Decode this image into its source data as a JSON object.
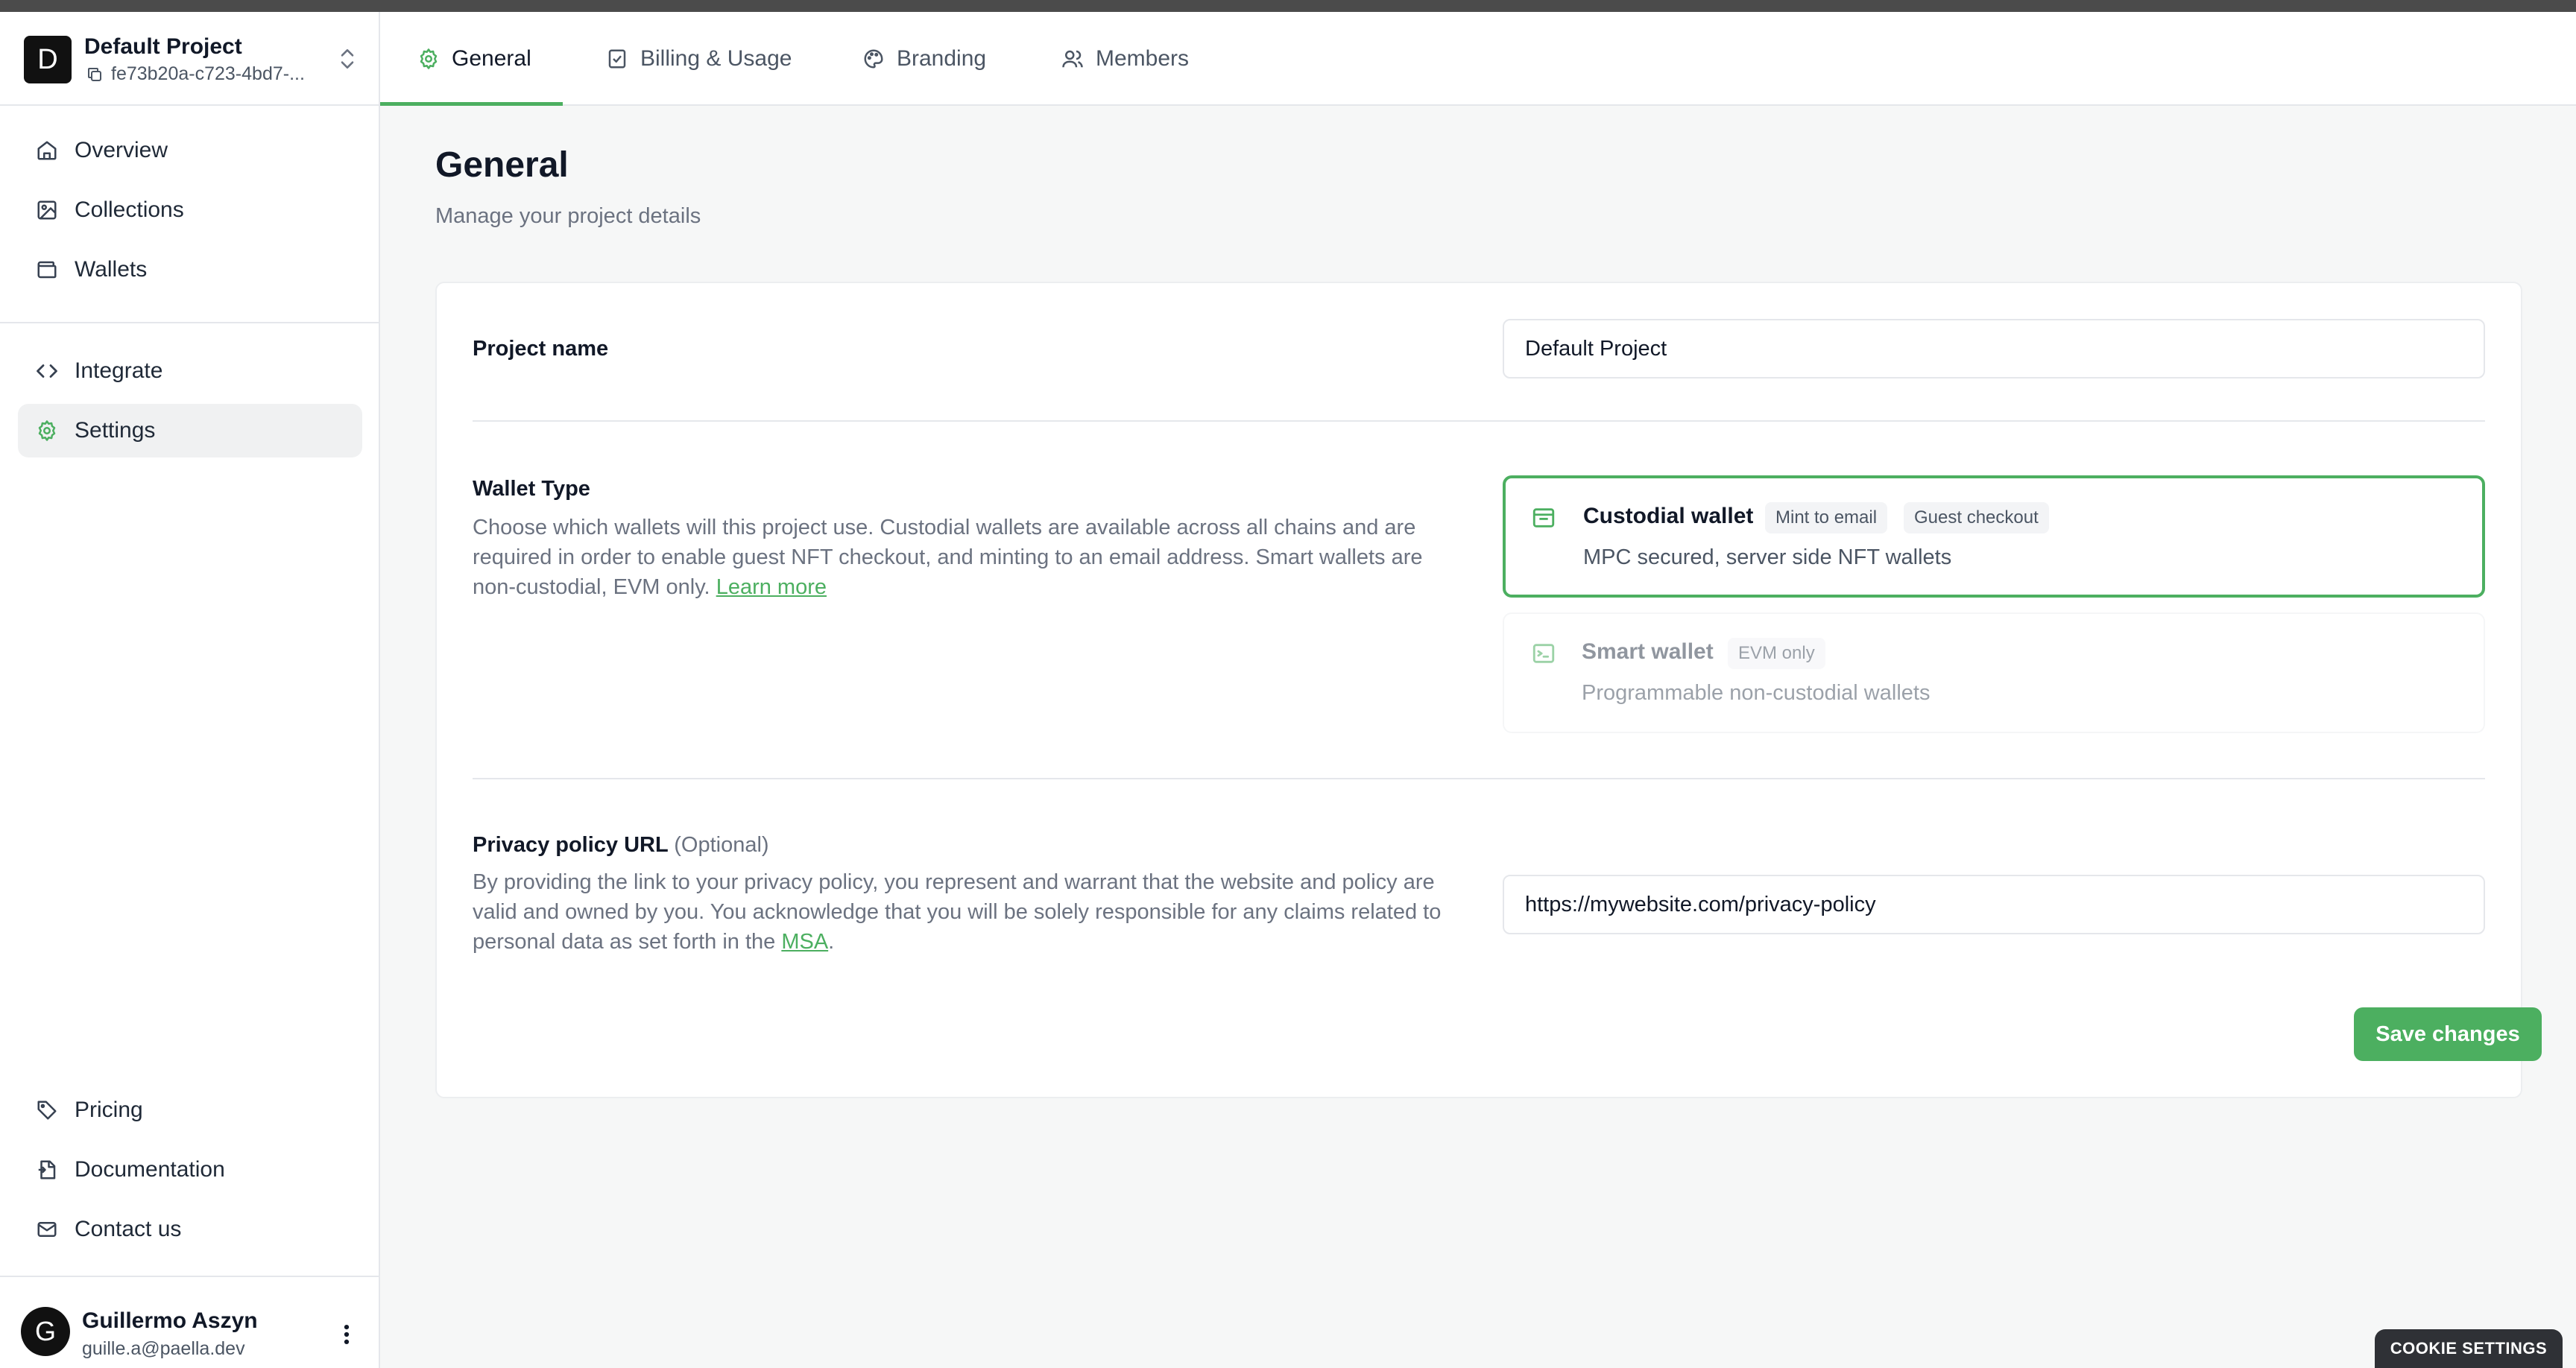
{
  "sidebar": {
    "project": {
      "initial": "D",
      "name": "Default Project",
      "id": "fe73b20a-c723-4bd7-..."
    },
    "nav_primary": [
      {
        "label": "Overview",
        "icon": "home-icon"
      },
      {
        "label": "Collections",
        "icon": "image-icon"
      },
      {
        "label": "Wallets",
        "icon": "wallet-icon"
      }
    ],
    "nav_secondary": [
      {
        "label": "Integrate",
        "icon": "code-icon"
      },
      {
        "label": "Settings",
        "icon": "gear-icon",
        "active": true
      }
    ],
    "nav_footer": [
      {
        "label": "Pricing",
        "icon": "tag-icon"
      },
      {
        "label": "Documentation",
        "icon": "document-icon"
      },
      {
        "label": "Contact us",
        "icon": "mail-icon"
      }
    ],
    "user": {
      "initial": "G",
      "name": "Guillermo Aszyn",
      "email": "guille.a@paella.dev"
    }
  },
  "tabs": [
    {
      "label": "General",
      "icon": "gear-icon",
      "active": true
    },
    {
      "label": "Billing & Usage",
      "icon": "receipt-icon"
    },
    {
      "label": "Branding",
      "icon": "palette-icon"
    },
    {
      "label": "Members",
      "icon": "users-icon"
    }
  ],
  "page": {
    "title": "General",
    "subtitle": "Manage your project details"
  },
  "project_name": {
    "label": "Project name",
    "value": "Default Project"
  },
  "wallet_type": {
    "label": "Wallet Type",
    "description": "Choose which wallets will this project use. Custodial wallets are available across all chains and are required in order to enable guest NFT checkout, and minting to an email address. Smart wallets are non-custodial, EVM only.",
    "link": "Learn more",
    "options": [
      {
        "title": "Custodial wallet",
        "badges": [
          "Mint to email",
          "Guest checkout"
        ],
        "subtitle": "MPC secured, server side NFT wallets",
        "selected": true
      },
      {
        "title": "Smart wallet",
        "badges": [
          "EVM only"
        ],
        "subtitle": "Programmable non-custodial wallets",
        "selected": false
      }
    ]
  },
  "privacy": {
    "label": "Privacy policy URL",
    "optional": "(Optional)",
    "description": "By providing the link to your privacy policy, you represent and warrant that the website and policy are valid and owned by you. You acknowledge that you will be solely responsible for any claims related to personal data as set forth in the",
    "link": "MSA",
    "value": "https://mywebsite.com/privacy-policy"
  },
  "save_label": "Save changes",
  "cookie_label": "COOKIE SETTINGS",
  "colors": {
    "accent": "#4caf60",
    "sidebar_active": "#f0f1f2",
    "main_bg": "#f6f7f7"
  }
}
